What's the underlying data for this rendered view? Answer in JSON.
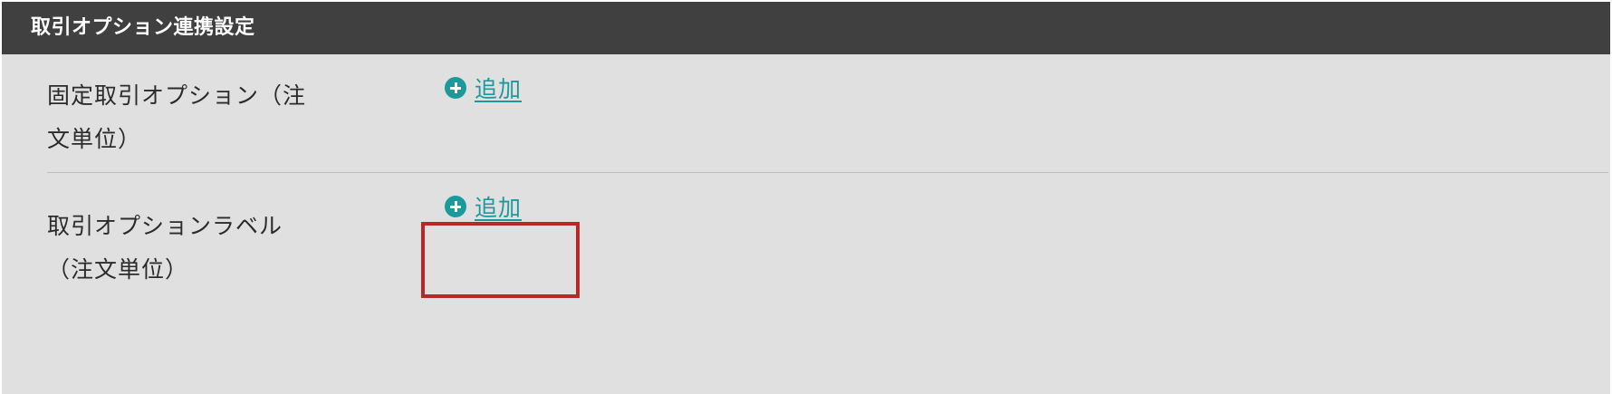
{
  "panel": {
    "title": "取引オプション連携設定"
  },
  "rows": [
    {
      "label_line1": "固定取引オプション（注",
      "label_line2": "文単位）",
      "add_label": "追加"
    },
    {
      "label_line1": "取引オプションラベル",
      "label_line2": "（注文単位）",
      "add_label": "追加"
    }
  ],
  "colors": {
    "header_bg": "#404040",
    "body_bg": "#e0e0e0",
    "accent": "#1a9a9a",
    "highlight": "#b82828"
  },
  "icons": {
    "add": "plus-circle-icon"
  }
}
